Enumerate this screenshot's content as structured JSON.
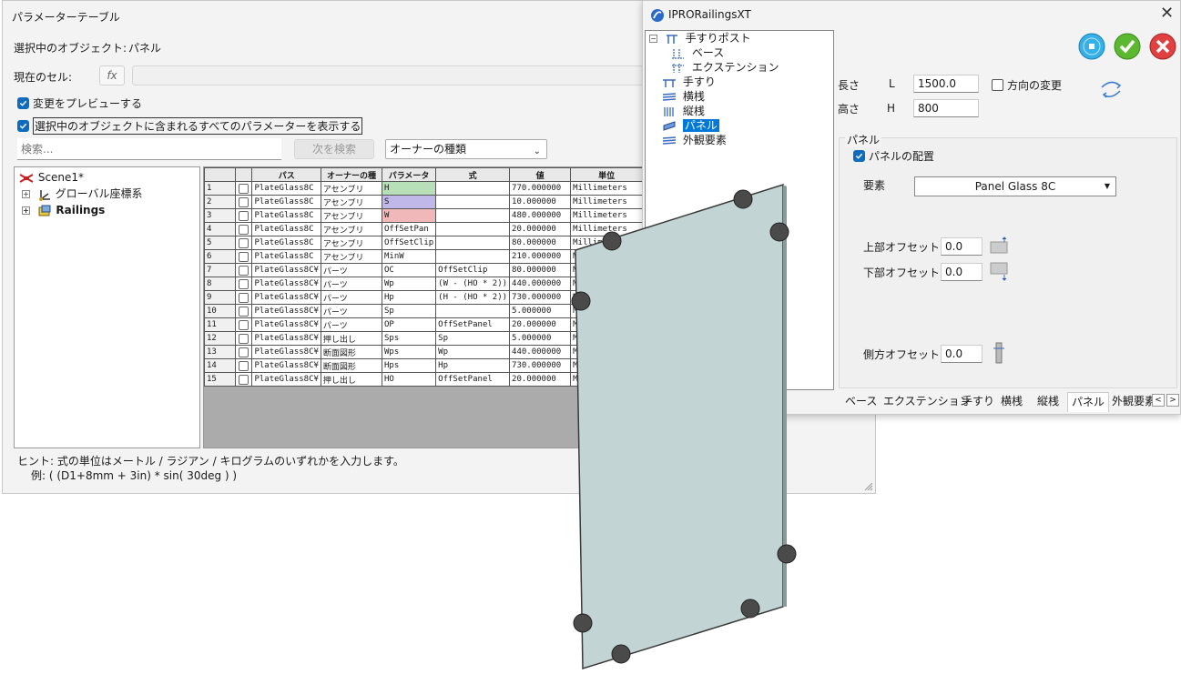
{
  "param_window": {
    "title": "パラメーターテーブル",
    "selected_object_label": "選択中のオブジェクト:",
    "selected_object_value": "パネル",
    "current_cell_label": "現在のセル:",
    "fx_label": "fx",
    "preview_checkbox_label": "変更をプレビューする",
    "preview_checked": true,
    "show_all_checkbox_label": "選択中のオブジェクトに含まれるすべてのパラメーターを表示する",
    "show_all_checked": true,
    "search_placeholder": "検索...",
    "find_next_button": "次を検索",
    "owner_type_dropdown": "オーナーの種類",
    "tree": {
      "root": "Scene1*",
      "items": [
        "グローバル座標系",
        "Railings"
      ]
    },
    "table": {
      "headers": [
        "",
        "",
        "パス",
        "オーナーの種",
        "パラメータ",
        "式",
        "値",
        "単位"
      ],
      "rows": [
        {
          "n": "1",
          "path": "PlateGlass8C",
          "owner": "アセンブリ",
          "param": "H",
          "formula": "",
          "value": "770.000000",
          "unit": "Millimeters",
          "color": "#b8e0b8"
        },
        {
          "n": "2",
          "path": "PlateGlass8C",
          "owner": "アセンブリ",
          "param": "S",
          "formula": "",
          "value": "10.000000",
          "unit": "Millimeters",
          "color": "#c0b8e8"
        },
        {
          "n": "3",
          "path": "PlateGlass8C",
          "owner": "アセンブリ",
          "param": "W",
          "formula": "",
          "value": "480.000000",
          "unit": "Millimeters",
          "color": "#f0b8b8"
        },
        {
          "n": "4",
          "path": "PlateGlass8C",
          "owner": "アセンブリ",
          "param": "OffSetPan",
          "formula": "",
          "value": "20.000000",
          "unit": "Millimeters",
          "color": ""
        },
        {
          "n": "5",
          "path": "PlateGlass8C",
          "owner": "アセンブリ",
          "param": "OffSetClip",
          "formula": "",
          "value": "80.000000",
          "unit": "Millimeters",
          "color": ""
        },
        {
          "n": "6",
          "path": "PlateGlass8C",
          "owner": "アセンブリ",
          "param": "MinW",
          "formula": "",
          "value": "210.000000",
          "unit": "Mi",
          "color": ""
        },
        {
          "n": "7",
          "path": "PlateGlass8C¥",
          "owner": "パーツ",
          "param": "OC",
          "formula": "OffSetClip",
          "value": "80.000000",
          "unit": "Mi",
          "color": ""
        },
        {
          "n": "8",
          "path": "PlateGlass8C¥",
          "owner": "パーツ",
          "param": "Wp",
          "formula": "(W - (HO * 2))",
          "value": "440.000000",
          "unit": "Mi",
          "color": ""
        },
        {
          "n": "9",
          "path": "PlateGlass8C¥",
          "owner": "パーツ",
          "param": "Hp",
          "formula": "(H - (HO * 2))",
          "value": "730.000000",
          "unit": "Mi",
          "color": ""
        },
        {
          "n": "10",
          "path": "PlateGlass8C¥",
          "owner": "パーツ",
          "param": "Sp",
          "formula": "",
          "value": "5.000000",
          "unit": "Mi",
          "color": ""
        },
        {
          "n": "11",
          "path": "PlateGlass8C¥",
          "owner": "パーツ",
          "param": "OP",
          "formula": "OffSetPanel",
          "value": "20.000000",
          "unit": "Mi",
          "color": ""
        },
        {
          "n": "12",
          "path": "PlateGlass8C¥",
          "owner": "押し出し",
          "param": "Sps",
          "formula": "Sp",
          "value": "5.000000",
          "unit": "Mi",
          "color": ""
        },
        {
          "n": "13",
          "path": "PlateGlass8C¥",
          "owner": "断面図形",
          "param": "Wps",
          "formula": "Wp",
          "value": "440.000000",
          "unit": "Mi",
          "color": ""
        },
        {
          "n": "14",
          "path": "PlateGlass8C¥",
          "owner": "断面図形",
          "param": "Hps",
          "formula": "Hp",
          "value": "730.000000",
          "unit": "Mi",
          "color": ""
        },
        {
          "n": "15",
          "path": "PlateGlass8C¥",
          "owner": "押し出し",
          "param": "HO",
          "formula": "OffSetPanel",
          "value": "20.000000",
          "unit": "Mi",
          "color": ""
        }
      ]
    },
    "hint_line1": "ヒント: 式の単位はメートル / ラジアン / キログラムのいずれかを入力します。",
    "hint_line2": "例: ( (D1+8mm + 3in) * sin( 30deg ) )"
  },
  "ipro_window": {
    "title": "IPRORailingsXT",
    "tree": [
      {
        "label": "手すりポスト",
        "level": 0
      },
      {
        "label": "ベース",
        "level": 1
      },
      {
        "label": "エクステンション",
        "level": 1
      },
      {
        "label": "手すり",
        "level": 0
      },
      {
        "label": "横桟",
        "level": 0
      },
      {
        "label": "縦桟",
        "level": 0
      },
      {
        "label": "パネル",
        "level": 0,
        "selected": true
      },
      {
        "label": "外観要素",
        "level": 0
      }
    ],
    "length_label": "長さ",
    "length_symbol": "L",
    "length_value": "1500.0",
    "height_label": "高さ",
    "height_symbol": "H",
    "height_value": "800",
    "flip_direction_label": "方向の変更",
    "flip_checked": false,
    "panel_group_label": "パネル",
    "panel_placement_label": "パネルの配置",
    "panel_placement_checked": true,
    "element_label": "要素",
    "element_value": "Panel Glass 8C",
    "top_offset_label": "上部オフセット",
    "top_offset_value": "0.0",
    "bottom_offset_label": "下部オフセット",
    "bottom_offset_value": "0.0",
    "side_offset_label": "側方オフセット",
    "side_offset_value": "0.0",
    "tabs": [
      "ベース",
      "エクステンション",
      "手すり",
      "横桟",
      "縦桟",
      "パネル",
      "外観要素"
    ],
    "active_tab": "パネル",
    "colors": {
      "info_button": "#35b0e8",
      "ok_button": "#5cb82e",
      "cancel_button": "#e04040",
      "selection": "#0078d7"
    }
  }
}
